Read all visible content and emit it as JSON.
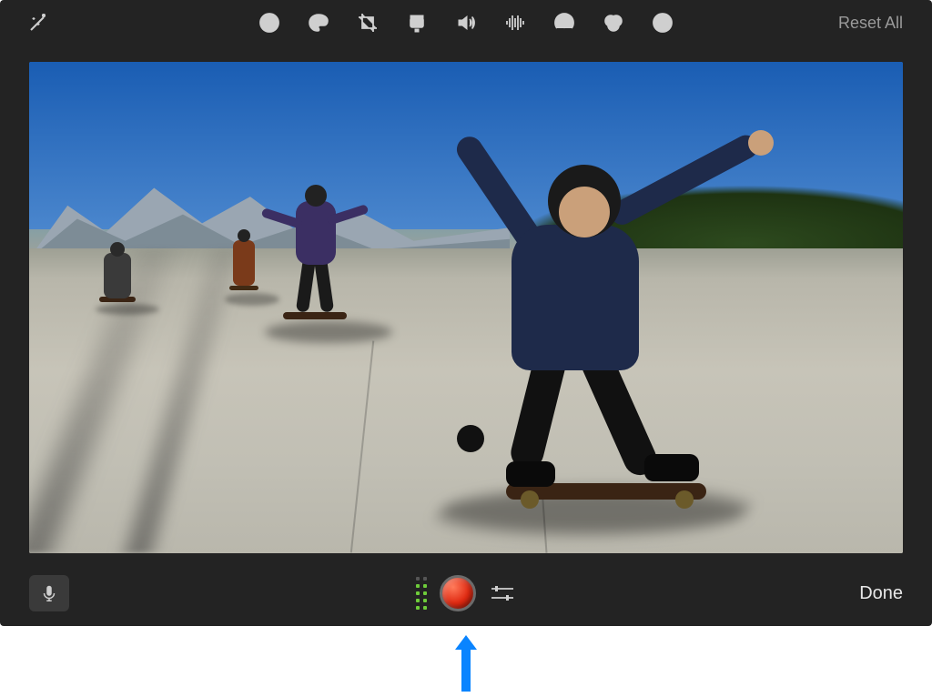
{
  "toolbar": {
    "wand": "magic-wand-icon",
    "items": [
      {
        "name": "adjust-icon"
      },
      {
        "name": "color-palette-icon"
      },
      {
        "name": "crop-icon"
      },
      {
        "name": "stabilization-icon"
      },
      {
        "name": "volume-icon"
      },
      {
        "name": "noise-reduction-icon"
      },
      {
        "name": "speed-icon"
      },
      {
        "name": "color-filter-icon"
      },
      {
        "name": "info-icon"
      }
    ],
    "reset_label": "Reset All"
  },
  "bottom": {
    "mic": "microphone-icon",
    "level_active_dots": 8,
    "level_total_dots": 10,
    "record": "record-button",
    "options": "voiceover-options-icon",
    "done_label": "Done"
  },
  "annotation": {
    "arrow_color": "#0a84ff"
  }
}
